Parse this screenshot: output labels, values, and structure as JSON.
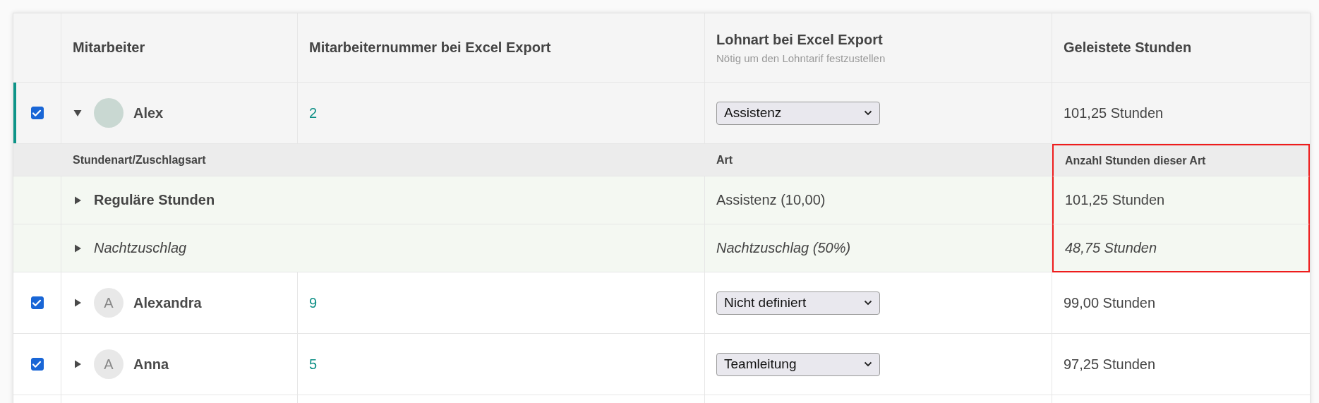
{
  "columns": [
    {
      "title": "Mitarbeiter"
    },
    {
      "title": "Mitarbeiternummer bei Excel Export"
    },
    {
      "title": "Lohnart bei Excel Export",
      "subtitle": "Nötig um den Lohntarif festzustellen"
    },
    {
      "title": "Geleistete Stunden"
    }
  ],
  "rows": [
    {
      "checked": true,
      "expanded": true,
      "kind": "photo",
      "name": "Alex",
      "number": "2",
      "wage_type": "Assistenz",
      "hours": "101,25 Stunden",
      "detail": {
        "columns": [
          {
            "title": "Stundenart/Zuschlagsart",
            "highlighted": false
          },
          {
            "title": "Art",
            "highlighted": false
          },
          {
            "title": "Anzahl Stunden dieser Art",
            "highlighted": true
          }
        ],
        "rows": [
          {
            "kind": "regular",
            "label": "Reguläre Stunden",
            "type": "Assistenz (10,00)",
            "hours": "101,25 Stunden"
          },
          {
            "kind": "surcharge",
            "label": "Nachtzuschlag",
            "type": "Nachtzuschlag (50%)",
            "hours": "48,75 Stunden"
          }
        ]
      }
    },
    {
      "checked": true,
      "expanded": false,
      "kind": "initial",
      "initial": "A",
      "name": "Alexandra",
      "number": "9",
      "wage_type": "Nicht definiert",
      "hours": "99,00 Stunden"
    },
    {
      "checked": true,
      "expanded": false,
      "kind": "initial",
      "initial": "A",
      "name": "Anna",
      "number": "5",
      "wage_type": "Teamleitung",
      "hours": "97,25 Stunden"
    }
  ]
}
